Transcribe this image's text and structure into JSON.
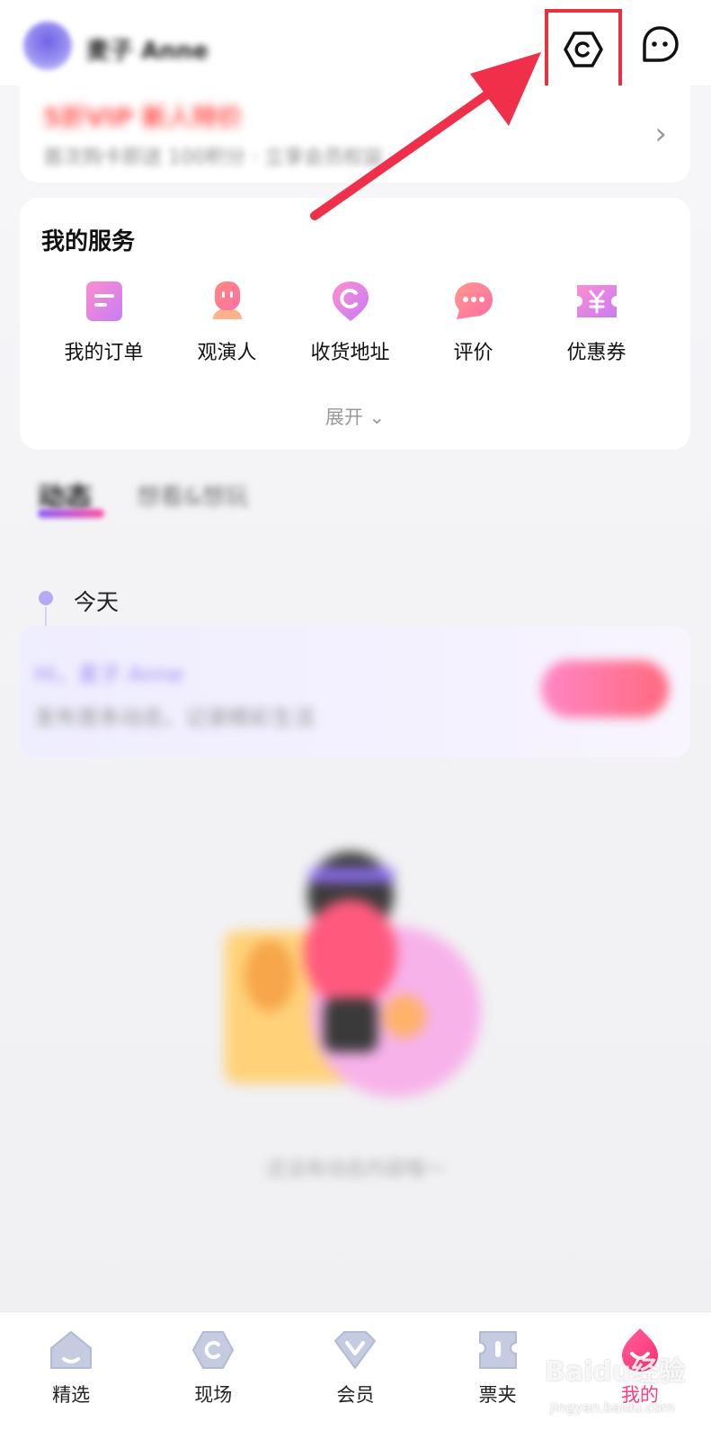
{
  "header": {
    "username": "麦子 Anne",
    "settings_icon": "settings-hexagon-icon",
    "message_icon": "message-bubble-icon"
  },
  "promo": {
    "title": "5折VIP 新人特价",
    "subtitle": "首次购卡即送 100积分 · 立享会员权益",
    "arrow": "›"
  },
  "services": {
    "title": "我的服务",
    "items": [
      {
        "label": "我的订单",
        "icon": "order-icon"
      },
      {
        "label": "观演人",
        "icon": "viewer-icon"
      },
      {
        "label": "收货地址",
        "icon": "address-icon"
      },
      {
        "label": "评价",
        "icon": "comment-icon"
      },
      {
        "label": "优惠券",
        "icon": "coupon-icon"
      }
    ],
    "expand_label": "展开 ⌄"
  },
  "tabs": {
    "active": "动态",
    "other": "想看&想玩"
  },
  "timeline": {
    "today": "今天"
  },
  "feed": {
    "greeting": "Hi，麦子 Anne",
    "description": "发布首条动态，记录精彩生活"
  },
  "empty_state": {
    "text": "还没有动态内容哦～"
  },
  "tabbar": {
    "items": [
      {
        "label": "精选",
        "icon": "home-icon"
      },
      {
        "label": "现场",
        "icon": "live-icon"
      },
      {
        "label": "会员",
        "icon": "vip-diamond-icon"
      },
      {
        "label": "票夹",
        "icon": "ticket-icon"
      },
      {
        "label": "我的",
        "icon": "profile-drop-icon",
        "active": true
      }
    ]
  },
  "colors": {
    "accent_pink": "#ff3d7f",
    "highlight_red": "#e8313f",
    "service_gradient_start": "#ff7ac2",
    "service_gradient_end": "#c679f5"
  },
  "watermark": {
    "brand": "Baidu经验",
    "url": "jingyan.baidu.com"
  }
}
